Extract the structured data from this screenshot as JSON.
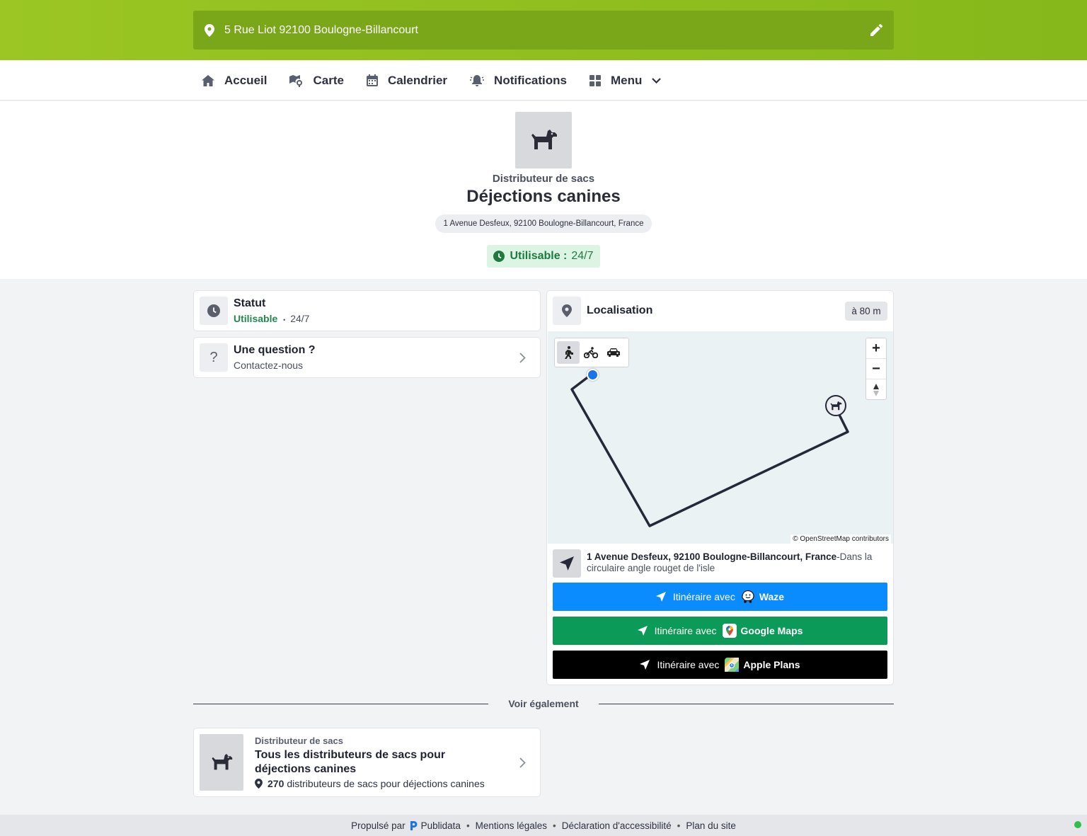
{
  "header": {
    "address": "5 Rue Liot 92100 Boulogne-Billancourt"
  },
  "nav": [
    {
      "label": "Accueil",
      "icon": "home-icon"
    },
    {
      "label": "Carte",
      "icon": "map-icon"
    },
    {
      "label": "Calendrier",
      "icon": "calendar-icon"
    },
    {
      "label": "Notifications",
      "icon": "bell-icon"
    },
    {
      "label": "Menu",
      "icon": "grid-icon"
    }
  ],
  "hero": {
    "category": "Distributeur de sacs",
    "title": "Déjections canines",
    "address": "1 Avenue Desfeux, 92100 Boulogne-Billancourt, France",
    "status_label": "Utilisable :",
    "status_value": "24/7"
  },
  "statut": {
    "title": "Statut",
    "status": "Utilisable",
    "sep": "•",
    "hours": "24/7"
  },
  "question": {
    "title": "Une question ?",
    "subtitle": "Contactez-nous"
  },
  "localisation": {
    "title": "Localisation",
    "distance": "à 80 m",
    "attribution": "© OpenStreetMap contributors",
    "address_bold": "1 Avenue Desfeux, 92100 Boulogne-Billancourt, France",
    "address_extra": "-Dans la circulaire angle rouget de l'isle",
    "buttons": {
      "prefix": "Itinéraire avec",
      "waze": "Waze",
      "google": "Google Maps",
      "apple": "Apple Plans"
    }
  },
  "see_also": {
    "heading": "Voir également",
    "category": "Distributeur de sacs",
    "title": "Tous les distributeurs de sacs pour déjections canines",
    "count": "270",
    "count_text": "distributeurs de sacs pour déjections canines"
  },
  "footer": {
    "powered": "Propulsé par",
    "brand": "Publidata",
    "links": [
      "Mentions légales",
      "Déclaration d'accessibilité",
      "Plan du site"
    ],
    "sep": "•"
  },
  "colors": {
    "brand_green": "#8fbf1f",
    "status_green": "#1f8a4a",
    "waze": "#0a8cff",
    "google": "#0b9a57",
    "apple": "#000000"
  }
}
